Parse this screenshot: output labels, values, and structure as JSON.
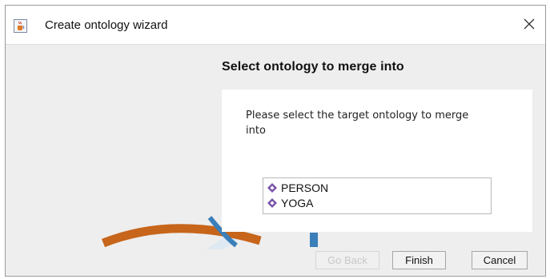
{
  "window": {
    "title": "Create ontology wizard",
    "app_icon": "java-cup-icon",
    "close_icon": "close-x-icon"
  },
  "wizard": {
    "heading": "Select ontology to merge into",
    "instruction": "Please select the target ontology to merge into",
    "ontologies": [
      {
        "label": "PERSON",
        "icon": "ontology-diamond-icon"
      },
      {
        "label": "YOGA",
        "icon": "ontology-diamond-icon"
      }
    ]
  },
  "buttons": {
    "back": "Go Back",
    "finish": "Finish",
    "cancel": "Cancel"
  },
  "colors": {
    "dialog_bg": "#eeeeee",
    "panel_bg": "#ffffff",
    "ontology_icon": "#7b55a8",
    "decor_orange": "#c7651a",
    "decor_blue": "#3a7fb9"
  }
}
